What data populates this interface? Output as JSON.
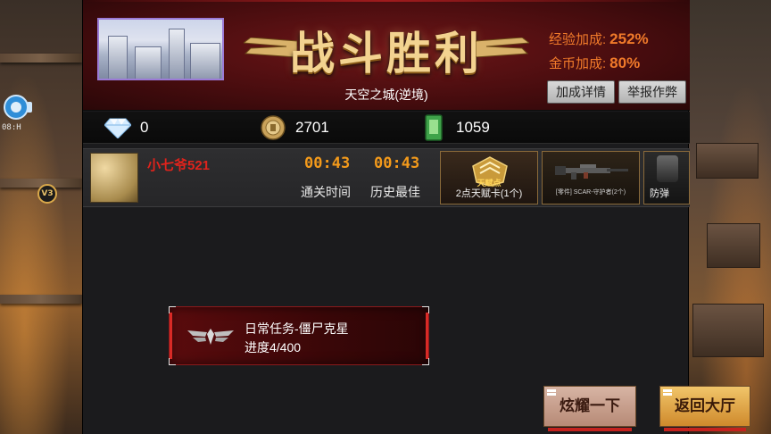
{
  "hud": {
    "side_text": "08:H"
  },
  "header": {
    "title": "战斗胜利",
    "map_name": "天空之城(逆境)",
    "exp_bonus_label": "经验加成:",
    "exp_bonus_value": "252%",
    "gold_bonus_label": "金币加成:",
    "gold_bonus_value": "80%",
    "bonus_detail_button": "加成详情",
    "report_button": "举报作弊"
  },
  "resources": {
    "diamond": "0",
    "gold": "2701",
    "card": "1059"
  },
  "player": {
    "name": "小七爷521",
    "vip": "V3",
    "clear_time": "00:43",
    "best_time": "00:43",
    "clear_time_label": "通关时间",
    "best_time_label": "历史最佳"
  },
  "rewards": [
    {
      "label": "2点天赋卡(1个)",
      "badge_text": "天赋点"
    },
    {
      "label": "[零件] SCAR-守护者(2个)"
    },
    {
      "label": "防弹"
    }
  ],
  "mission": {
    "title": "日常任务-僵尸克星",
    "progress": "进度4/400"
  },
  "buttons": {
    "share": "炫耀一下",
    "back": "返回大厅"
  },
  "colors": {
    "bonus": "#f07a2a",
    "time": "#f39a1b",
    "player_name": "#e0231c",
    "title_gold": "#f3d390"
  }
}
